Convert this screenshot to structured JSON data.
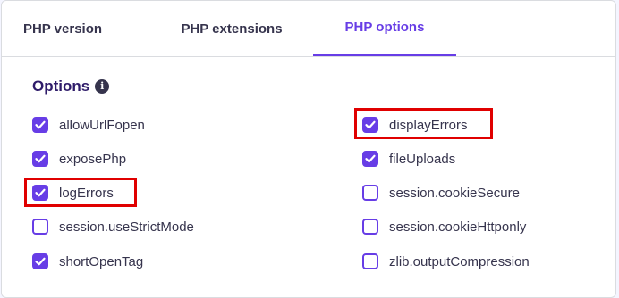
{
  "tabs": [
    {
      "label": "PHP version",
      "active": false
    },
    {
      "label": "PHP extensions",
      "active": false
    },
    {
      "label": "PHP options",
      "active": true
    }
  ],
  "options_section": {
    "title": "Options",
    "info_icon": "info-icon"
  },
  "options": {
    "left": [
      {
        "label": "allowUrlFopen",
        "checked": true,
        "highlighted": false
      },
      {
        "label": "exposePhp",
        "checked": true,
        "highlighted": false
      },
      {
        "label": "logErrors",
        "checked": true,
        "highlighted": true
      },
      {
        "label": "session.useStrictMode",
        "checked": false,
        "highlighted": false
      },
      {
        "label": "shortOpenTag",
        "checked": true,
        "highlighted": false
      }
    ],
    "right": [
      {
        "label": "displayErrors",
        "checked": true,
        "highlighted": true
      },
      {
        "label": "fileUploads",
        "checked": true,
        "highlighted": false
      },
      {
        "label": "session.cookieSecure",
        "checked": false,
        "highlighted": false
      },
      {
        "label": "session.cookieHttponly",
        "checked": false,
        "highlighted": false
      },
      {
        "label": "zlib.outputCompression",
        "checked": false,
        "highlighted": false
      }
    ]
  },
  "colors": {
    "accent": "#673de6",
    "text": "#36344d",
    "highlight": "#e00000"
  }
}
